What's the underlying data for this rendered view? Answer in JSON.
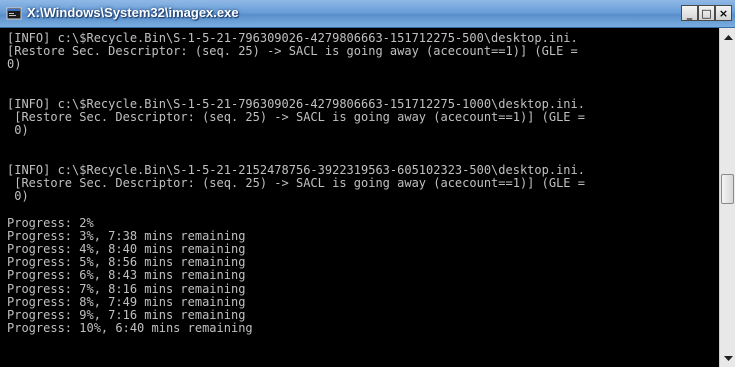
{
  "window": {
    "title": "X:\\Windows\\System32\\imagex.exe",
    "controls": {
      "minimize": "_",
      "maximize": "□",
      "close": "×"
    },
    "icon": "console-window-icon"
  },
  "console": {
    "lines": [
      "[INFO] c:\\$Recycle.Bin\\S-1-5-21-796309026-4279806663-151712275-500\\desktop.ini.",
      "[Restore Sec. Descriptor: (seq. 25) -> SACL is going away (acecount==1)] (GLE =",
      "0)",
      "",
      "",
      "[INFO] c:\\$Recycle.Bin\\S-1-5-21-796309026-4279806663-151712275-1000\\desktop.ini.",
      " [Restore Sec. Descriptor: (seq. 25) -> SACL is going away (acecount==1)] (GLE =",
      " 0)",
      "",
      "",
      "[INFO] c:\\$Recycle.Bin\\S-1-5-21-2152478756-3922319563-605102323-500\\desktop.ini.",
      " [Restore Sec. Descriptor: (seq. 25) -> SACL is going away (acecount==1)] (GLE =",
      " 0)",
      "",
      "Progress: 2%",
      "Progress: 3%, 7:38 mins remaining",
      "Progress: 4%, 8:40 mins remaining",
      "Progress: 5%, 8:56 mins remaining",
      "Progress: 6%, 8:43 mins remaining",
      "Progress: 7%, 8:16 mins remaining",
      "Progress: 8%, 7:49 mins remaining",
      "Progress: 9%, 7:16 mins remaining",
      "Progress: 10%, 6:40 mins remaining"
    ]
  },
  "scrollbar": {
    "up_icon": "arrow-up-icon",
    "down_icon": "arrow-down-icon",
    "position": 0.43
  },
  "colors": {
    "titlebar": "#6a9fd8",
    "console_bg": "#000000",
    "console_text": "#c0c0c0"
  }
}
